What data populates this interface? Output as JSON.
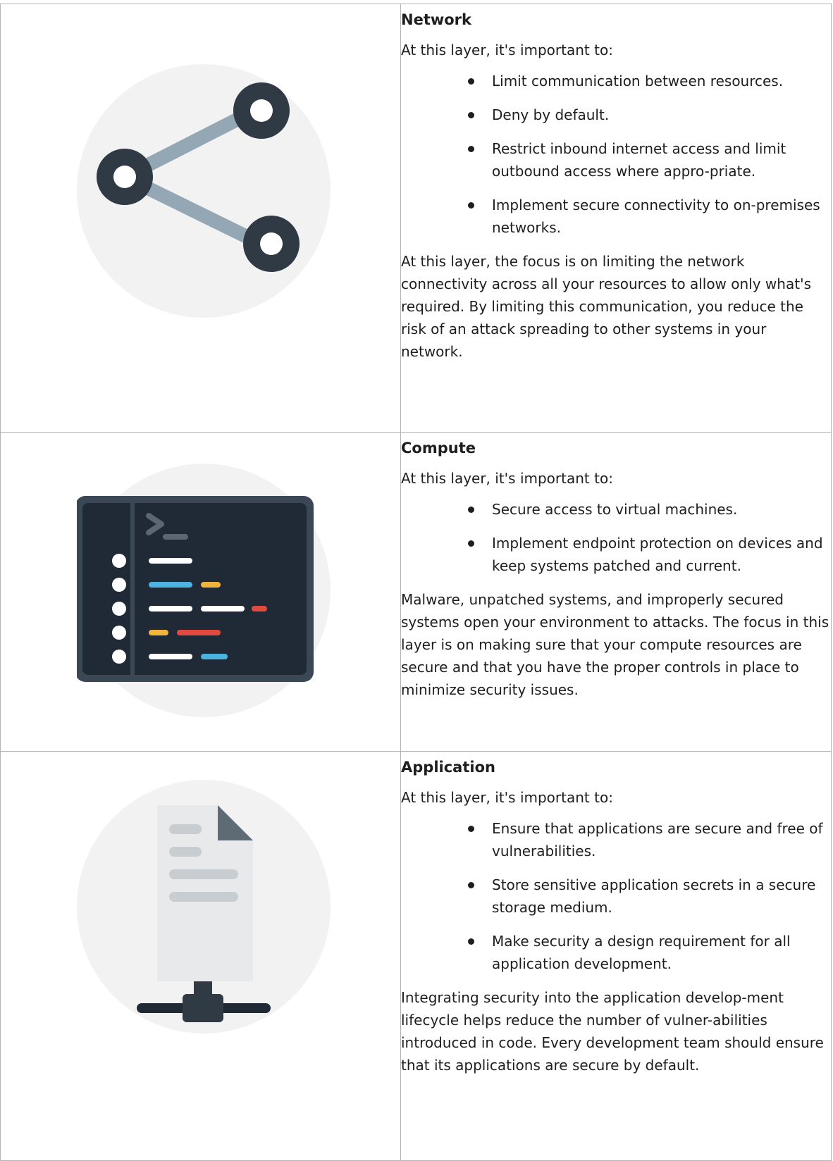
{
  "layers": [
    {
      "title": "Network",
      "icon": "share-network-icon",
      "intro": "At this layer, it's important to:",
      "points": [
        "Limit communication between resources.",
        "Deny by default.",
        "Restrict inbound internet access and limit outbound access where appro-priate.",
        "Implement secure connectivity to on-premises networks."
      ],
      "summary": "At this layer, the focus is on limiting the network connectivity across all your resources to allow only what's required. By limiting this communication, you reduce the risk of an attack spreading to other systems in your network."
    },
    {
      "title": "Compute",
      "icon": "terminal-window-icon",
      "intro": "At this layer, it's important to:",
      "points": [
        "Secure access to virtual machines.",
        "Implement endpoint protection on devices and keep systems patched and current."
      ],
      "summary": "Malware, unpatched systems, and improperly secured systems open your environment to attacks. The focus in this layer is on making sure that your compute resources are secure and that you have the proper controls in place to minimize security issues."
    },
    {
      "title": "Application",
      "icon": "networked-document-icon",
      "intro": "At this layer, it's important to:",
      "points": [
        "Ensure that applications are secure and free of vulnerabilities.",
        "Store sensitive application secrets in a secure storage medium.",
        "Make security a design requirement for all application development."
      ],
      "summary": "Integrating security into the application develop-ment lifecycle helps reduce the number of vulner-abilities introduced in code. Every development team should ensure that its applications are secure by default."
    }
  ],
  "colors": {
    "circle_bg": "#f2f2f2",
    "icon_dark": "#2f3a45",
    "icon_mid": "#5b6670",
    "link_line": "#93a7b4",
    "terminal_bg": "#1f2a36",
    "terminal_frame": "#3b4754",
    "code_white": "#ffffff",
    "code_blue": "#4cb3e0",
    "code_yellow": "#f0b43c",
    "code_red": "#e04a3f",
    "doc_paper": "#e7e9ea",
    "doc_line": "#c7cdd1",
    "doc_fold": "#5f6b74",
    "border": "#b3b3b3"
  }
}
